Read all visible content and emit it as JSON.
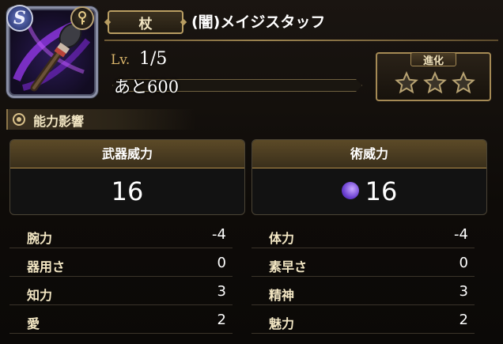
{
  "weapon": {
    "rarity_badge": "S",
    "type": "杖",
    "name": "(闇)メイジスタッフ"
  },
  "level": {
    "label": "Lv.",
    "value": "1/5",
    "remaining": "あと600",
    "progress": 0.0
  },
  "evolution": {
    "title": "進化",
    "stars_filled": 0,
    "stars_total": 3
  },
  "ability": {
    "header": "能力影響"
  },
  "power": {
    "weapon_label": "武器威力",
    "weapon_value": "16",
    "magic_label": "術威力",
    "magic_value": "16"
  },
  "stats_left": [
    {
      "label": "腕力",
      "value": "-4"
    },
    {
      "label": "器用さ",
      "value": "0"
    },
    {
      "label": "知力",
      "value": "3"
    },
    {
      "label": "愛",
      "value": "2"
    }
  ],
  "stats_right": [
    {
      "label": "体力",
      "value": "-4"
    },
    {
      "label": "素早さ",
      "value": "0"
    },
    {
      "label": "精神",
      "value": "3"
    },
    {
      "label": "魅力",
      "value": "2"
    }
  ],
  "colors": {
    "gold": "#b89d62",
    "label_gold": "#f3e7c4",
    "magic_purple": "#6a3fd1"
  }
}
